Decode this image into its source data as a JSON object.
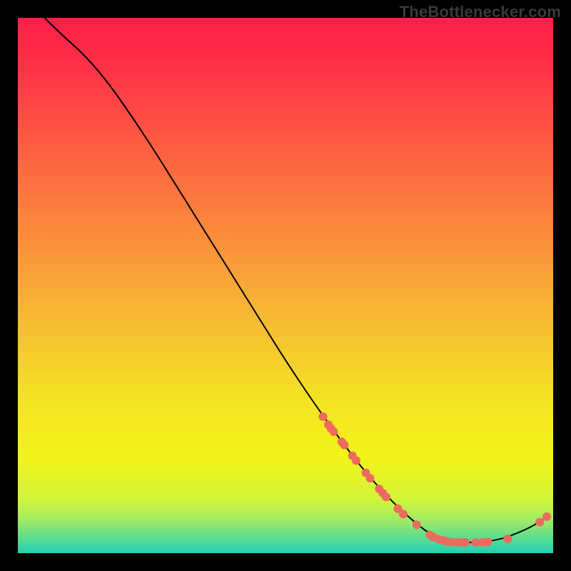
{
  "watermark": "TheBottlenecker.com",
  "chart_data": {
    "type": "line",
    "title": "",
    "xlabel": "",
    "ylabel": "",
    "xlim": [
      0,
      100
    ],
    "ylim": [
      0,
      100
    ],
    "grid": false,
    "legend": false,
    "curve": {
      "name": "bottleneck-curve",
      "color": "#000000",
      "points": [
        {
          "x": 5.0,
          "y": 100.0
        },
        {
          "x": 8.0,
          "y": 97.0
        },
        {
          "x": 12.0,
          "y": 93.5
        },
        {
          "x": 16.0,
          "y": 89.0
        },
        {
          "x": 20.0,
          "y": 83.5
        },
        {
          "x": 25.0,
          "y": 76.0
        },
        {
          "x": 30.0,
          "y": 68.0
        },
        {
          "x": 35.0,
          "y": 60.0
        },
        {
          "x": 40.0,
          "y": 52.0
        },
        {
          "x": 45.0,
          "y": 44.0
        },
        {
          "x": 50.0,
          "y": 36.0
        },
        {
          "x": 55.0,
          "y": 28.5
        },
        {
          "x": 60.0,
          "y": 21.5
        },
        {
          "x": 65.0,
          "y": 15.0
        },
        {
          "x": 70.0,
          "y": 9.5
        },
        {
          "x": 75.0,
          "y": 5.0
        },
        {
          "x": 78.0,
          "y": 3.0
        },
        {
          "x": 82.0,
          "y": 2.0
        },
        {
          "x": 86.0,
          "y": 2.0
        },
        {
          "x": 90.0,
          "y": 2.5
        },
        {
          "x": 94.0,
          "y": 4.0
        },
        {
          "x": 97.0,
          "y": 5.5
        },
        {
          "x": 99.0,
          "y": 7.0
        }
      ]
    },
    "scatter": {
      "name": "data-points",
      "color": "#EC6B5E",
      "radius": 6,
      "points": [
        {
          "x": 57.0,
          "y": 25.5
        },
        {
          "x": 58.0,
          "y": 24.0
        },
        {
          "x": 58.5,
          "y": 23.3
        },
        {
          "x": 59.0,
          "y": 22.7
        },
        {
          "x": 60.5,
          "y": 20.8
        },
        {
          "x": 61.0,
          "y": 20.2
        },
        {
          "x": 62.5,
          "y": 18.2
        },
        {
          "x": 63.2,
          "y": 17.3
        },
        {
          "x": 65.0,
          "y": 15.0
        },
        {
          "x": 65.8,
          "y": 14.0
        },
        {
          "x": 67.5,
          "y": 12.0
        },
        {
          "x": 68.2,
          "y": 11.2
        },
        {
          "x": 68.8,
          "y": 10.5
        },
        {
          "x": 71.0,
          "y": 8.3
        },
        {
          "x": 72.0,
          "y": 7.3
        },
        {
          "x": 74.5,
          "y": 5.3
        },
        {
          "x": 77.0,
          "y": 3.4
        },
        {
          "x": 77.6,
          "y": 3.0
        },
        {
          "x": 78.6,
          "y": 2.6
        },
        {
          "x": 79.4,
          "y": 2.4
        },
        {
          "x": 80.0,
          "y": 2.2
        },
        {
          "x": 80.8,
          "y": 2.1
        },
        {
          "x": 81.8,
          "y": 2.0
        },
        {
          "x": 82.6,
          "y": 2.0
        },
        {
          "x": 83.6,
          "y": 2.0
        },
        {
          "x": 85.5,
          "y": 2.0
        },
        {
          "x": 86.8,
          "y": 2.0
        },
        {
          "x": 87.8,
          "y": 2.1
        },
        {
          "x": 91.5,
          "y": 2.7
        },
        {
          "x": 97.5,
          "y": 5.8
        },
        {
          "x": 98.8,
          "y": 6.8
        }
      ]
    },
    "background_gradient": {
      "type": "vertical",
      "stops": [
        {
          "pos": 0.0,
          "color": "#FF1E49"
        },
        {
          "pos": 0.1,
          "color": "#FF3347"
        },
        {
          "pos": 0.22,
          "color": "#FE5843"
        },
        {
          "pos": 0.35,
          "color": "#FC7C3F"
        },
        {
          "pos": 0.48,
          "color": "#F9A239"
        },
        {
          "pos": 0.6,
          "color": "#F6C530"
        },
        {
          "pos": 0.72,
          "color": "#F4E423"
        },
        {
          "pos": 0.82,
          "color": "#F3F41A"
        },
        {
          "pos": 0.9,
          "color": "#D2F43A"
        },
        {
          "pos": 0.94,
          "color": "#9EEB66"
        },
        {
          "pos": 0.97,
          "color": "#5FDD8F"
        },
        {
          "pos": 1.0,
          "color": "#22CFB5"
        }
      ]
    }
  }
}
